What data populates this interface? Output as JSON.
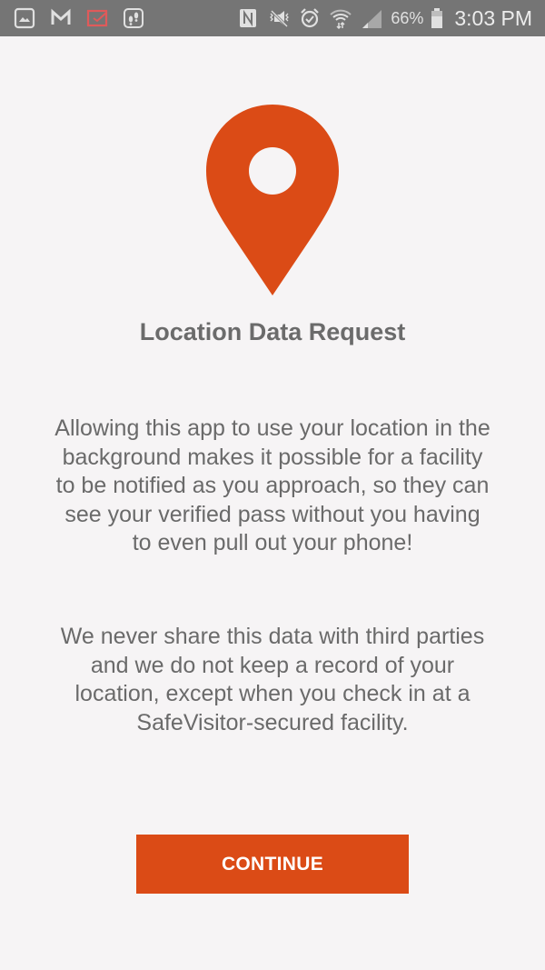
{
  "status_bar": {
    "notification_icons": [
      "gallery-icon",
      "gmail-icon",
      "email-icon",
      "step-counter-icon"
    ],
    "system_icons": [
      "nfc-icon",
      "vibrate-mute-icon",
      "alarm-icon",
      "wifi-icon",
      "cell-signal-icon",
      "battery-icon"
    ],
    "battery_percent": "66%",
    "time": "3:03 PM"
  },
  "icon": "location-pin-icon",
  "accent_color": "#db4b16",
  "title": "Location Data Request",
  "paragraphs": [
    "Allowing this app to use your location in the background makes it possible for a facility to be notified as you approach, so they can see your verified pass without you having to even pull out your phone!",
    "We never share this data with third parties and we do not keep a record of your location, except when you check in at a SafeVisitor-secured facility."
  ],
  "continue_button": {
    "label": "CONTINUE"
  }
}
